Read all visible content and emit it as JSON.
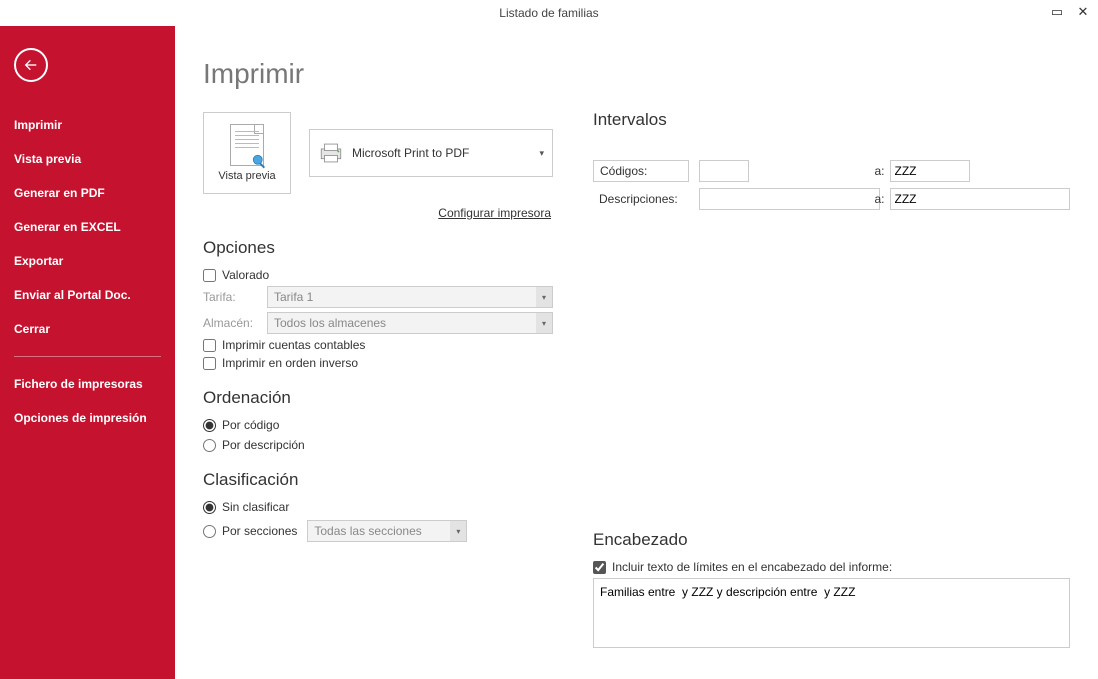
{
  "window": {
    "title": "Listado de familias"
  },
  "sidebar": {
    "items": [
      "Imprimir",
      "Vista previa",
      "Generar en PDF",
      "Generar en EXCEL",
      "Exportar",
      "Enviar al Portal Doc.",
      "Cerrar"
    ],
    "items2": [
      "Fichero de impresoras",
      "Opciones de impresión"
    ]
  },
  "page": {
    "title": "Imprimir",
    "preview_label": "Vista previa",
    "printer_selected": "Microsoft Print to PDF",
    "config_link": "Configurar impresora"
  },
  "opciones": {
    "heading": "Opciones",
    "valorado_label": "Valorado",
    "tarifa_label": "Tarifa:",
    "tarifa_value": "Tarifa 1",
    "almacen_label": "Almacén:",
    "almacen_value": "Todos los almacenes",
    "cuentas_label": "Imprimir cuentas contables",
    "inverso_label": "Imprimir en orden inverso"
  },
  "orden": {
    "heading": "Ordenación",
    "por_codigo": "Por código",
    "por_desc": "Por descripción"
  },
  "clasi": {
    "heading": "Clasificación",
    "sin": "Sin clasificar",
    "por_secc": "Por secciones",
    "secc_value": "Todas las secciones"
  },
  "interval": {
    "heading": "Intervalos",
    "codigos_label": "Códigos:",
    "codigos_from": "",
    "a": "a:",
    "codigos_to": "ZZZ",
    "desc_label": "Descripciones:",
    "desc_from": "",
    "desc_to": "ZZZ"
  },
  "encabezado": {
    "heading": "Encabezado",
    "incluir_label": "Incluir texto de límites en el encabezado del informe:",
    "text": "Familias entre  y ZZZ y descripción entre  y ZZZ"
  }
}
